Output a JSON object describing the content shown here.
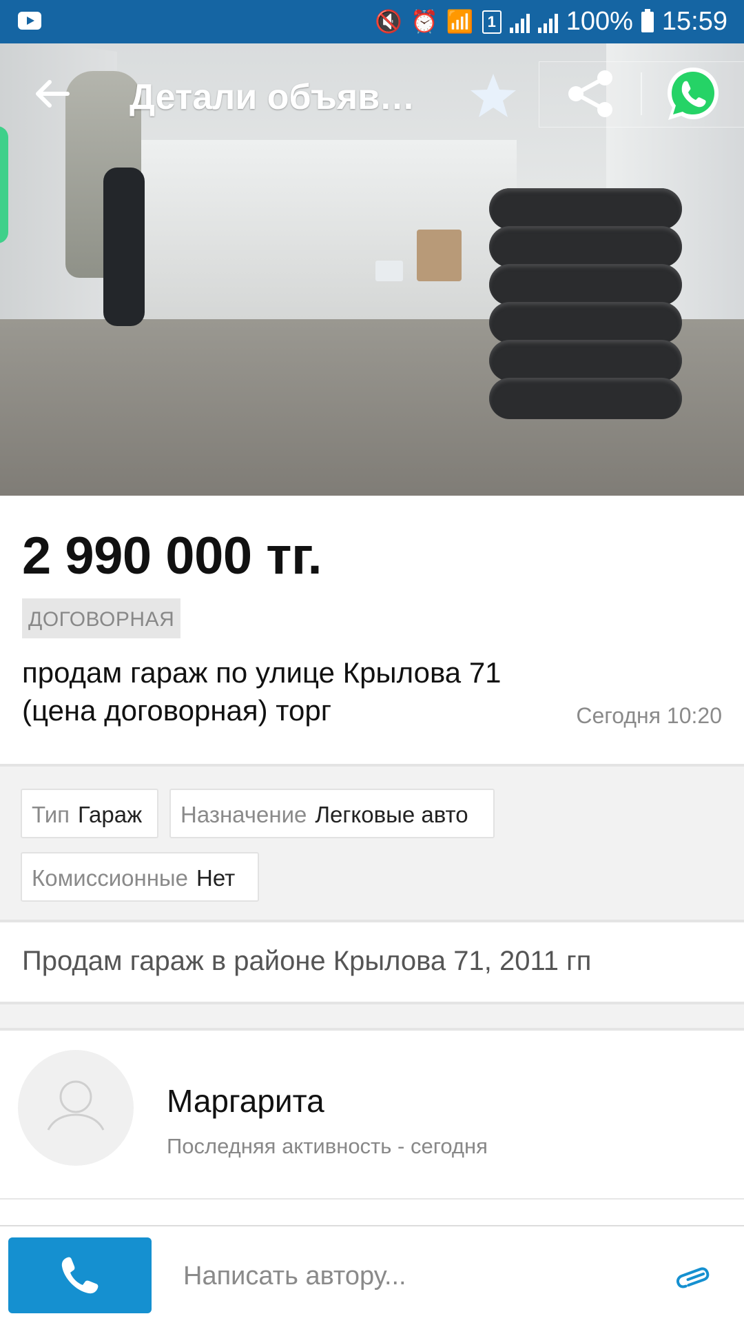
{
  "status_bar": {
    "battery": "100%",
    "time": "15:59",
    "sim_slot": "1"
  },
  "header": {
    "title": "Детали объявл…",
    "icons": [
      "back-arrow-icon",
      "star-icon",
      "share-icon",
      "whatsapp-icon"
    ]
  },
  "listing": {
    "price": "2 990 000 тг.",
    "price_badge": "ДОГОВОРНАЯ",
    "title": "продам гараж по улице Крылова 71 (цена договорная) торг",
    "date": "Сегодня 10:20"
  },
  "params": [
    {
      "key": "Тип",
      "value": "Гараж"
    },
    {
      "key": "Назначение",
      "value": "Легковые авто"
    },
    {
      "key": "Комиссионные",
      "value": "Нет"
    }
  ],
  "description": "Продам гараж в районе Крылова 71, 2011 гп",
  "author": {
    "name": "Маргарита",
    "activity": "Последняя активность - сегодня"
  },
  "bottom_bar": {
    "message_placeholder": "Написать автору..."
  },
  "colors": {
    "status_bar": "#1565a3",
    "accent": "#1590d0",
    "whatsapp": "#25d366"
  }
}
